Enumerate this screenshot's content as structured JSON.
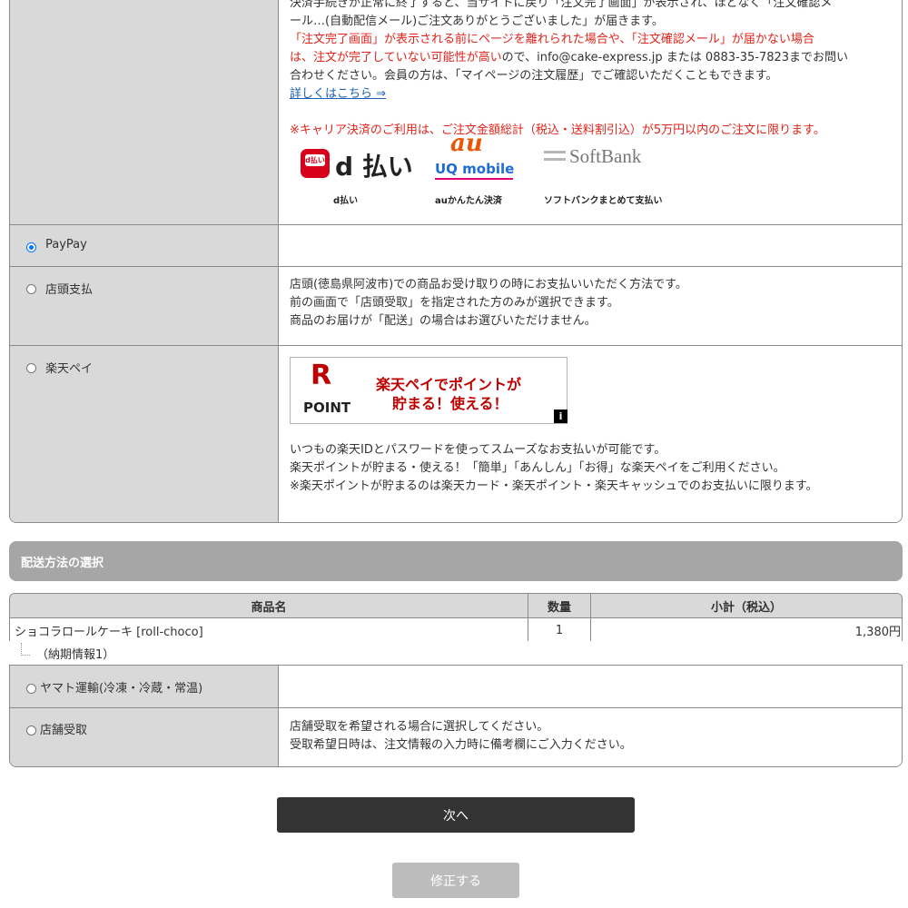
{
  "carrier_section": {
    "line1": "決済手続きが正常に終了すると、当サイトに戻り「注文完了画面」が表示され、ほどなく「注文確認メ",
    "line2": "ール…(自動配信メール)ご注文ありがとうございました」が届きます。",
    "line3": "「注文完了画面」が表示される前にページを離れられた場合や、「注文確認メール」が届かない場合",
    "line4_red": "は、注文が完了していない可能性が高い",
    "line4_rest": "ので、info@cake-express.jp または 0883-35-7823までお問い",
    "line5": "合わせください。会員の方は、「マイページの注文履歴」でご確認いただくこともできます。",
    "details_link": "詳しくはこちら ⇒",
    "limit_note": "※キャリア決済のご利用は、ご注文金額総計（税込・送料割引込）が5万円以内のご注文に限ります。",
    "logos": {
      "dpay_badge": "d払い",
      "dpay_text": "d 払い",
      "au_text": "au",
      "uq_text": "UQ mobile",
      "softbank_text": "SoftBank"
    },
    "captions": [
      "d払い",
      "auかんたん決済",
      "ソフトバンクまとめて支払い"
    ]
  },
  "payment_options": {
    "paypay": {
      "label": "PayPay",
      "selected": true
    },
    "store_pay": {
      "label": "店頭支払",
      "desc": [
        "店頭(徳島県阿波市)での商品お受け取りの時にお支払いいただく方法です。",
        "前の画面で「店頭受取」を指定された方のみが選択できます。",
        "商品のお届けが「配送」の場合はお選びいただけません。"
      ]
    },
    "rakuten": {
      "label": "楽天ペイ",
      "banner_r": "R",
      "banner_point": "POINT",
      "banner_line1": "楽天ペイでポイントが",
      "banner_line2": "貯まる！使える！",
      "banner_info": "i",
      "desc": [
        "いつもの楽天IDとパスワードを使ってスムーズなお支払いが可能です。",
        "楽天ポイントが貯まる・使える！「簡単」「あんしん」「お得」な楽天ペイをご利用ください。",
        "※楽天ポイントが貯まるのは楽天カード・楽天ポイント・楽天キャッシュでのお支払いに限ります。"
      ]
    }
  },
  "shipping": {
    "header": "配送方法の選択",
    "table": {
      "headers": [
        "商品名",
        "数量",
        "小計（税込）"
      ],
      "rows": [
        {
          "name": "ショコラロールケーキ [roll-choco]",
          "qty": "1",
          "subtotal": "1,380円"
        }
      ],
      "delivery_info": "（納期情報1）"
    },
    "options": {
      "yamato": {
        "label": "ヤマト運輸(冷凍・冷蔵・常温)"
      },
      "store_pickup": {
        "label": "店舗受取",
        "desc": [
          "店舗受取を希望される場合に選択してください。",
          "受取希望日時は、注文情報の入力時に備考欄にご入力ください。"
        ]
      }
    }
  },
  "buttons": {
    "next": "次へ",
    "edit": "修正する"
  },
  "colors": {
    "accent_red": "#e0241b",
    "link_blue": "#1a5fb4",
    "radio_blue": "#0075ff",
    "dark_button": "#333333"
  }
}
